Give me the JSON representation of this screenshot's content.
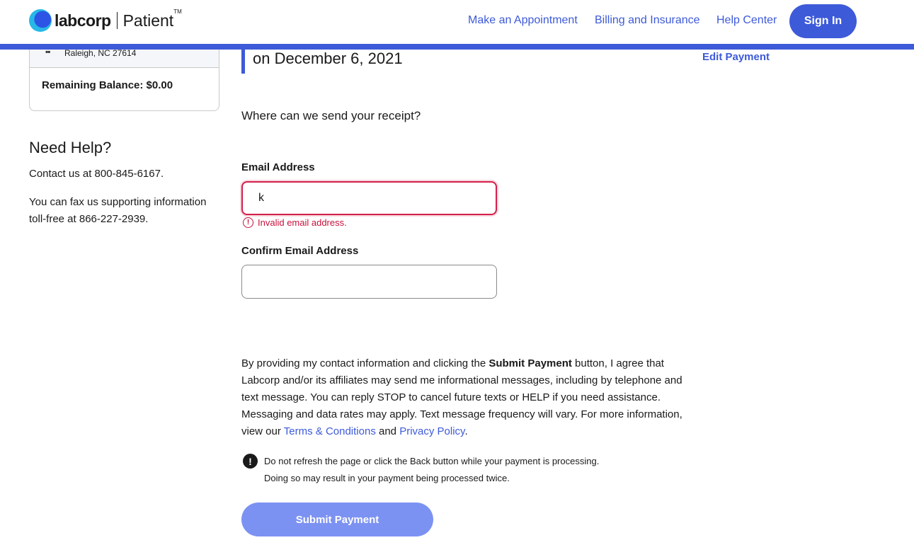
{
  "header": {
    "logo_brand": "labcorp",
    "logo_product": "Patient",
    "logo_tm": "TM",
    "nav": [
      "Make an Appointment",
      "Billing and Insurance",
      "Help Center"
    ],
    "sign_in": "Sign In",
    "accent_color": "#3d5ad8"
  },
  "summary": {
    "icon": "building-icon",
    "address_line": "Raleigh, NC 27614",
    "balance": "Remaining Balance: $0.00"
  },
  "help": {
    "title": "Need Help?",
    "contact": "Contact us at 800-845-6167.",
    "fax_line1": "You can fax us supporting information",
    "fax_line2": "toll-free at 866-227-2939."
  },
  "main": {
    "title_tail": "on December 6, 2021",
    "edit_payment": "Edit Payment",
    "receipt_question": "Where can we send your receipt?",
    "email_label": "Email Address",
    "email_value": "k",
    "email_error": "Invalid email address.",
    "confirm_label": "Confirm Email Address",
    "confirm_value": "",
    "consent_1": "By providing my contact information and clicking the ",
    "consent_bold": "Submit Payment",
    "consent_2": " button, I agree that Labcorp and/or its affiliates may send me informational messages, including by telephone and text message. You can reply STOP to cancel future texts or HELP if you need assistance. Messaging and data rates may apply. Text message frequency will vary. For more information, view our ",
    "terms_link": "Terms & Conditions",
    "consent_and": " and ",
    "privacy_link": "Privacy Policy",
    "consent_end": ".",
    "warning_line1": "Do not refresh the page or click the Back button while your payment is processing.",
    "warning_line2": "Doing so may result in your payment being processed twice.",
    "submit": "Submit Payment",
    "error_color": "#c8103c"
  }
}
